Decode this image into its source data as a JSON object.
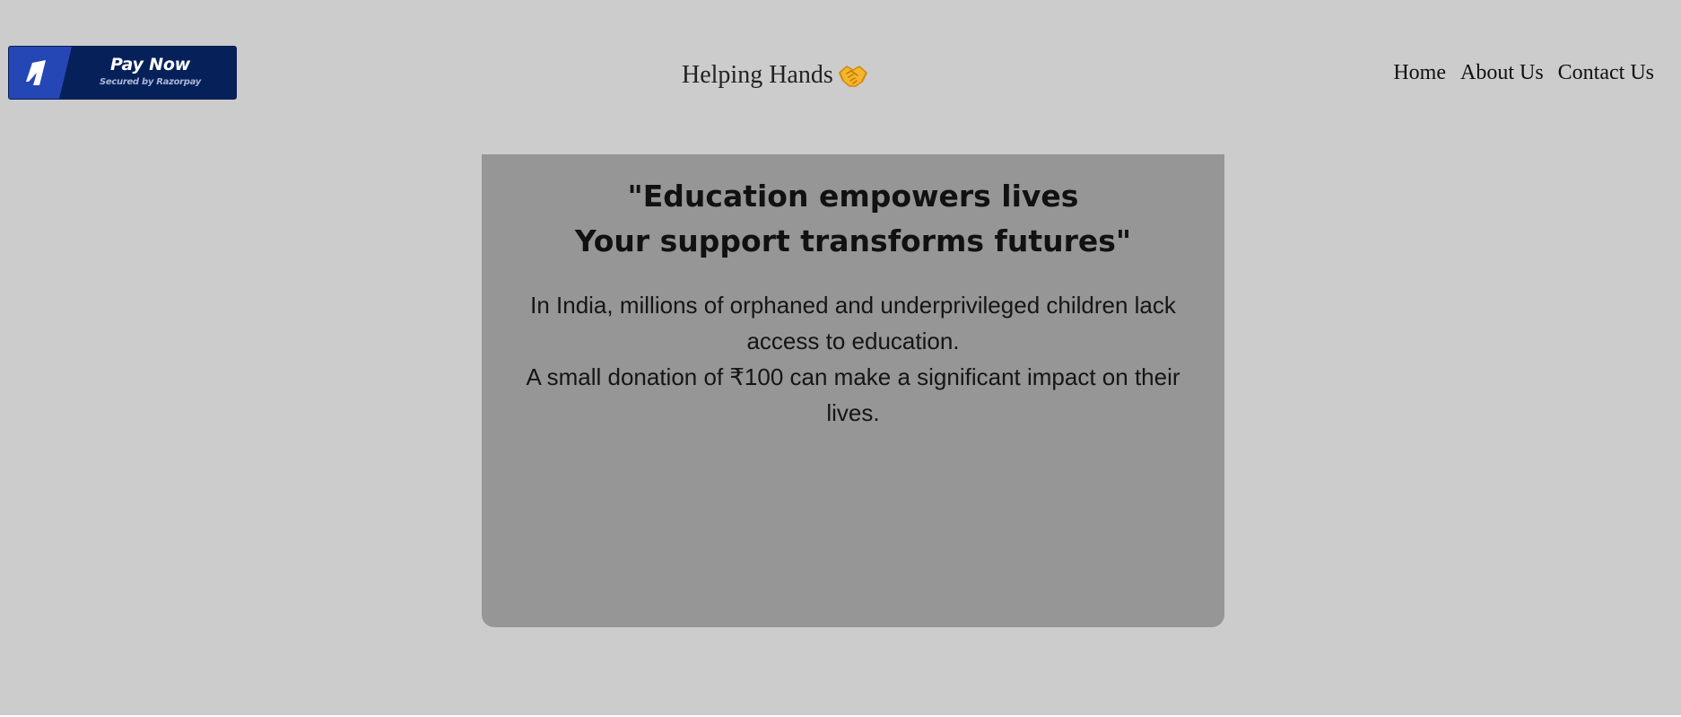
{
  "payment": {
    "label": "Pay Now",
    "sublabel": "Secured by Razorpay",
    "brand_color": "#06215a",
    "accent_color": "#2547b5",
    "icon": "razorpay-logo-icon"
  },
  "brand": {
    "name": "Helping Hands",
    "icon": "handshake-icon"
  },
  "nav": {
    "home": "Home",
    "about": "About Us",
    "contact": "Contact Us"
  },
  "hero": {
    "quote_line1": "\"Education empowers lives",
    "quote_line2": "Your support transforms futures\"",
    "paragraph1": "In India, millions of orphaned and underprivileged children lack access to education.",
    "paragraph2": "A small donation of ₹100 can make a significant impact on their lives."
  },
  "colors": {
    "page_background": "#cccccc",
    "card_background": "#969696"
  }
}
